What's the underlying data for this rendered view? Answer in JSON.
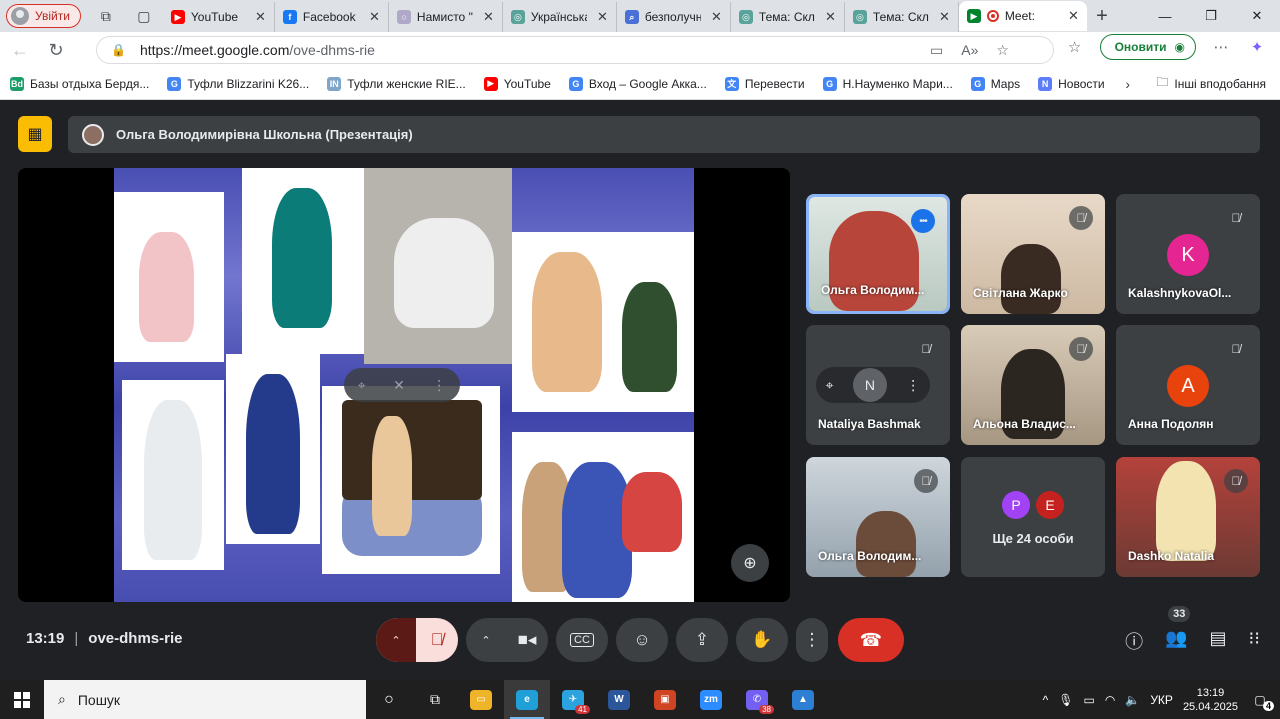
{
  "browser": {
    "profile_label": "Увійти",
    "tabs": [
      {
        "title": "YouTube",
        "color": "#ff0000",
        "glyph": "▶"
      },
      {
        "title": "Facebook",
        "color": "#1877f2",
        "glyph": "f"
      },
      {
        "title": "Намисто \"І",
        "color": "#b0a8c8",
        "glyph": "○"
      },
      {
        "title": "Українська",
        "color": "#5aa39b",
        "glyph": "◎"
      },
      {
        "title": "безполучн",
        "color": "#4a6fd6",
        "glyph": "⌕"
      },
      {
        "title": "Тема: Склад",
        "color": "#5aa39b",
        "glyph": "◎"
      },
      {
        "title": "Тема: Склад",
        "color": "#5aa39b",
        "glyph": "◎"
      }
    ],
    "active_tab": {
      "title": "Meet:"
    },
    "new_tab": "+",
    "url_host": "https://meet.google.com",
    "url_path": "/ove-dhms-rie",
    "update_label": "Оновити",
    "bookmarks": [
      {
        "label": "Базы отдыха Бердя...",
        "color": "#1a9e6a",
        "glyph": "Bd"
      },
      {
        "label": "Туфли Blizzarini K26...",
        "color": "#4285f4",
        "glyph": "G"
      },
      {
        "label": "Туфли женские RIE...",
        "color": "#7fa6c9",
        "glyph": "IN"
      },
      {
        "label": "YouTube",
        "color": "#ff0000",
        "glyph": "▶"
      },
      {
        "label": "Вход – Google Акка...",
        "color": "#4285f4",
        "glyph": "G"
      },
      {
        "label": "Перевести",
        "color": "#4285f4",
        "glyph": "文"
      },
      {
        "label": "Н.Науменко Мари...",
        "color": "#4285f4",
        "glyph": "G"
      },
      {
        "label": "Maps",
        "color": "#4285f4",
        "glyph": "G"
      },
      {
        "label": "Новости",
        "color": "#5c7cfa",
        "glyph": "N"
      }
    ],
    "bookmarks_folder": "Інші вподобання"
  },
  "meet": {
    "presenter_bar": "Ольга Володимирівна Школьна (Презентація)",
    "participants": [
      {
        "name": "Ольга Володим...",
        "type": "video",
        "speaking": true
      },
      {
        "name": "Світлана Жарко",
        "type": "video",
        "speaking": false
      },
      {
        "name": "KalashnykovaOl...",
        "type": "avatar",
        "initial": "K",
        "color": "#e52592"
      },
      {
        "name": "Nataliya Bashmak",
        "type": "avatar-hover",
        "initial": "N",
        "color": "#3c4043"
      },
      {
        "name": "Альона Владис...",
        "type": "video",
        "speaking": false
      },
      {
        "name": "Анна Подолян",
        "type": "avatar",
        "initial": "A",
        "color": "#e8430d"
      },
      {
        "name": "Ольга Володим...",
        "type": "video",
        "speaking": false
      },
      {
        "name": "Ще 24 особи",
        "type": "others",
        "initials": [
          "P",
          "E"
        ],
        "colors": [
          "#a142f4",
          "#c5221f"
        ]
      },
      {
        "name": "Dashko Natalia",
        "type": "video",
        "speaking": false
      }
    ],
    "time": "13:19",
    "meeting_code": "ove-dhms-rie",
    "participant_count": "33"
  },
  "taskbar": {
    "search_placeholder": "Пошук",
    "apps": [
      {
        "name": "file-explorer",
        "color": "#f0b429",
        "glyph": "▭"
      },
      {
        "name": "edge",
        "color": "#1fa0d8",
        "glyph": "e",
        "active": true
      },
      {
        "name": "telegram",
        "color": "#2aa3df",
        "glyph": "✈",
        "badge": "41"
      },
      {
        "name": "word",
        "color": "#2b579a",
        "glyph": "W"
      },
      {
        "name": "powerpoint-viewer",
        "color": "#d04423",
        "glyph": "▣"
      },
      {
        "name": "zoom",
        "color": "#2d8cff",
        "glyph": "zm"
      },
      {
        "name": "viber",
        "color": "#7360f2",
        "glyph": "✆",
        "badge": "38"
      },
      {
        "name": "photos",
        "color": "#2d7fd3",
        "glyph": "▲"
      }
    ],
    "language": "УКР",
    "time": "13:19",
    "date": "25.04.2025",
    "notifications": "4"
  }
}
